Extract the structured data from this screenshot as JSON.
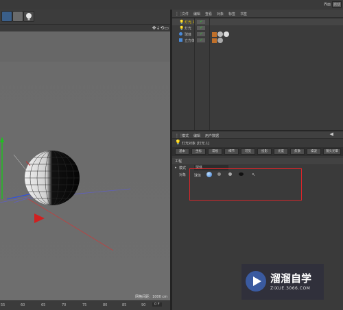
{
  "top_right": {
    "layout_label": "界面",
    "layout_value": "启动"
  },
  "object_manager": {
    "menu": [
      "文件",
      "编辑",
      "查看",
      "对象",
      "标签",
      "书签"
    ],
    "objects": [
      {
        "name": "灯光.1",
        "color": "#e0c000"
      },
      {
        "name": "灯光",
        "color": "#c8c8c8"
      },
      {
        "name": "球体",
        "color": "#c8c8c8"
      },
      {
        "name": "立方体",
        "color": "#c8c8c8"
      }
    ]
  },
  "attribute_manager": {
    "menu": [
      "模式",
      "编辑",
      "用户数据"
    ],
    "title": "灯光对象 [灯光.1]",
    "tabs": [
      "基本",
      "坐标",
      "常规",
      "细节",
      "可见",
      "投影",
      "光度",
      "焦散",
      "噪波",
      "镜头光晕"
    ],
    "section": "工程",
    "mode_label": "模式",
    "mode_value": "球体",
    "object_label": "对象",
    "object_value": "球体"
  },
  "viewport": {
    "grid_spacing": "网格间距：1000 cm"
  },
  "timeline": {
    "ticks": [
      "55",
      "60",
      "65",
      "70",
      "75",
      "80",
      "85",
      "90"
    ],
    "frame": "0 F"
  },
  "watermark": {
    "brand": "溜溜自学",
    "url": "ZIXUE.3066.COM"
  }
}
